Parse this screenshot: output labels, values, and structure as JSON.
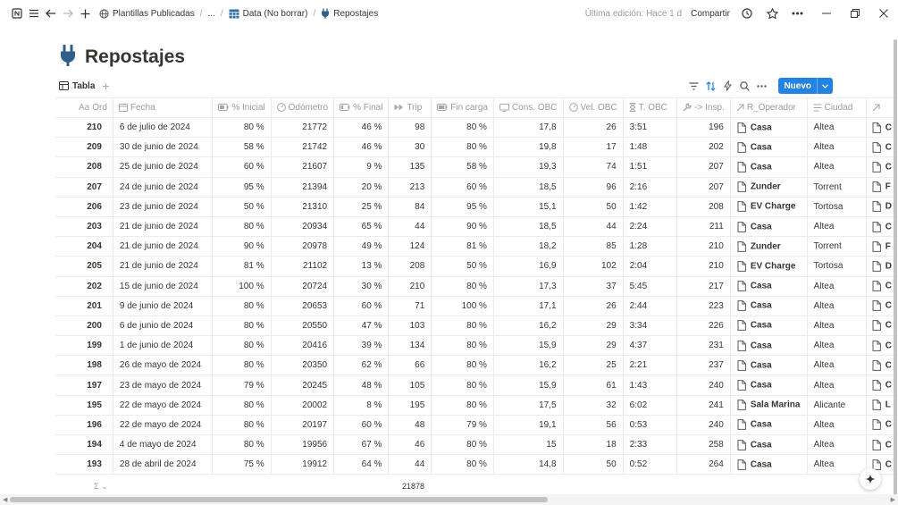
{
  "topbar": {
    "crumbs": [
      "Plantillas Publicadas",
      "...",
      "Data (No borrar)",
      "Repostajes"
    ],
    "edited": "Última edición: Hace 1 d",
    "share": "Compartir"
  },
  "page": {
    "title": "Repostajes"
  },
  "view": {
    "tab_label": "Tabla",
    "new_label": "Nuevo"
  },
  "columns": [
    "Ord",
    "Fecha",
    "% Inicial",
    "Odómetro",
    "% Final",
    "Trip",
    "Fin carga",
    "Cons. OBC",
    "Vel. OBC",
    "T. OBC",
    "-> Insp.",
    "R_Operador",
    "Ciudad",
    ""
  ],
  "rows": [
    [
      "210",
      "6 de julio de 2024",
      "80 %",
      "21772",
      "46 %",
      "98",
      "80 %",
      "17,8",
      "26",
      "3:51",
      "196",
      "Casa",
      "Altea",
      "C"
    ],
    [
      "209",
      "30 de junio de 2024",
      "58 %",
      "21742",
      "46 %",
      "30",
      "80 %",
      "19,8",
      "17",
      "1:48",
      "202",
      "Casa",
      "Altea",
      "C"
    ],
    [
      "208",
      "25 de junio de 2024",
      "60 %",
      "21607",
      "9 %",
      "135",
      "58 %",
      "19,3",
      "74",
      "1:51",
      "207",
      "Casa",
      "Altea",
      "C"
    ],
    [
      "207",
      "24 de junio de 2024",
      "95 %",
      "21394",
      "20 %",
      "213",
      "60 %",
      "18,5",
      "96",
      "2:16",
      "207",
      "Zunder",
      "Torrent",
      "F"
    ],
    [
      "206",
      "23 de junio de 2024",
      "50 %",
      "21310",
      "25 %",
      "84",
      "95 %",
      "15,1",
      "50",
      "1:42",
      "208",
      "EV Charge",
      "Tortosa",
      "D"
    ],
    [
      "203",
      "21 de junio de 2024",
      "80 %",
      "20934",
      "65 %",
      "44",
      "90 %",
      "18,5",
      "44",
      "2:24",
      "211",
      "Casa",
      "Altea",
      "C"
    ],
    [
      "204",
      "21 de junio de 2024",
      "90 %",
      "20978",
      "49 %",
      "124",
      "81 %",
      "18,2",
      "85",
      "1:28",
      "210",
      "Zunder",
      "Torrent",
      "F"
    ],
    [
      "205",
      "21 de junio de 2024",
      "81 %",
      "21102",
      "13 %",
      "208",
      "50 %",
      "16,9",
      "102",
      "2:04",
      "210",
      "EV Charge",
      "Tortosa",
      "D"
    ],
    [
      "202",
      "15 de junio de 2024",
      "100 %",
      "20724",
      "30 %",
      "210",
      "80 %",
      "17,3",
      "37",
      "5:45",
      "217",
      "Casa",
      "Altea",
      "C"
    ],
    [
      "201",
      "9 de junio de 2024",
      "80 %",
      "20653",
      "60 %",
      "71",
      "100 %",
      "17,1",
      "26",
      "2:44",
      "223",
      "Casa",
      "Altea",
      "C"
    ],
    [
      "200",
      "6 de junio de 2024",
      "80 %",
      "20550",
      "47 %",
      "103",
      "80 %",
      "16,2",
      "29",
      "3:34",
      "226",
      "Casa",
      "Altea",
      "C"
    ],
    [
      "199",
      "1 de junio de 2024",
      "80 %",
      "20416",
      "39 %",
      "134",
      "80 %",
      "15,9",
      "29",
      "4:37",
      "231",
      "Casa",
      "Altea",
      "C"
    ],
    [
      "198",
      "26 de mayo de 2024",
      "80 %",
      "20350",
      "62 %",
      "66",
      "80 %",
      "16,2",
      "25",
      "2:21",
      "237",
      "Casa",
      "Altea",
      "C"
    ],
    [
      "197",
      "23 de mayo de 2024",
      "79 %",
      "20245",
      "48 %",
      "105",
      "80 %",
      "15,9",
      "61",
      "1:43",
      "240",
      "Casa",
      "Altea",
      "C"
    ],
    [
      "195",
      "22 de mayo de 2024",
      "80 %",
      "20002",
      "8 %",
      "195",
      "80 %",
      "17,5",
      "32",
      "6:02",
      "241",
      "Sala Marina",
      "Alicante",
      "L"
    ],
    [
      "196",
      "22 de mayo de 2024",
      "80 %",
      "20197",
      "60 %",
      "48",
      "79 %",
      "19,1",
      "56",
      "0:53",
      "240",
      "Casa",
      "Altea",
      "C"
    ],
    [
      "194",
      "4 de mayo de 2024",
      "80 %",
      "19956",
      "67 %",
      "46",
      "80 %",
      "15",
      "18",
      "2:33",
      "258",
      "Casa",
      "Altea",
      "C"
    ],
    [
      "193",
      "28 de abril de 2024",
      "75 %",
      "19912",
      "64 %",
      "44",
      "80 %",
      "14,8",
      "50",
      "0:52",
      "264",
      "Casa",
      "Altea",
      "C"
    ]
  ],
  "footer": {
    "sigma": "Σ ⌄",
    "odometer_sum": "21878"
  }
}
